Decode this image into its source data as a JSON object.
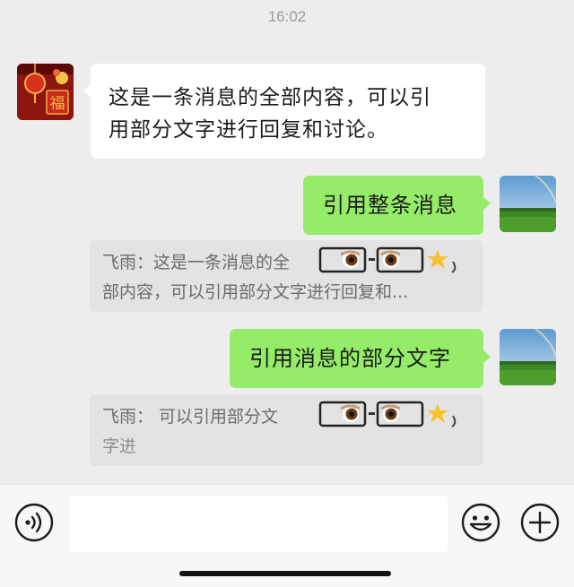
{
  "header": {
    "time": "16:02"
  },
  "messages": {
    "received": {
      "line1": "这是一条消息的全部内容，可以引",
      "line2": "用部分文字进行回复和讨论。"
    },
    "sent_full": {
      "text": "引用整条消息"
    },
    "quote_full": {
      "line1": "飞雨：这是一条消息的全",
      "line2": "部内容，可以引用部分文字进行回复和..."
    },
    "sent_partial": {
      "text": "引用消息的部分文字"
    },
    "quote_partial": {
      "line1": "飞雨：  可以引用部分文",
      "line2": "字进"
    }
  },
  "icons": {
    "voice": "voice-icon",
    "emoji": "emoji-icon",
    "plus": "plus-icon",
    "sticker": "peek-eyes-sticker"
  },
  "colors": {
    "background": "#ededed",
    "sent_bubble": "#95ec69",
    "received_bubble": "#ffffff",
    "quote_bg": "#e3e3e3"
  }
}
